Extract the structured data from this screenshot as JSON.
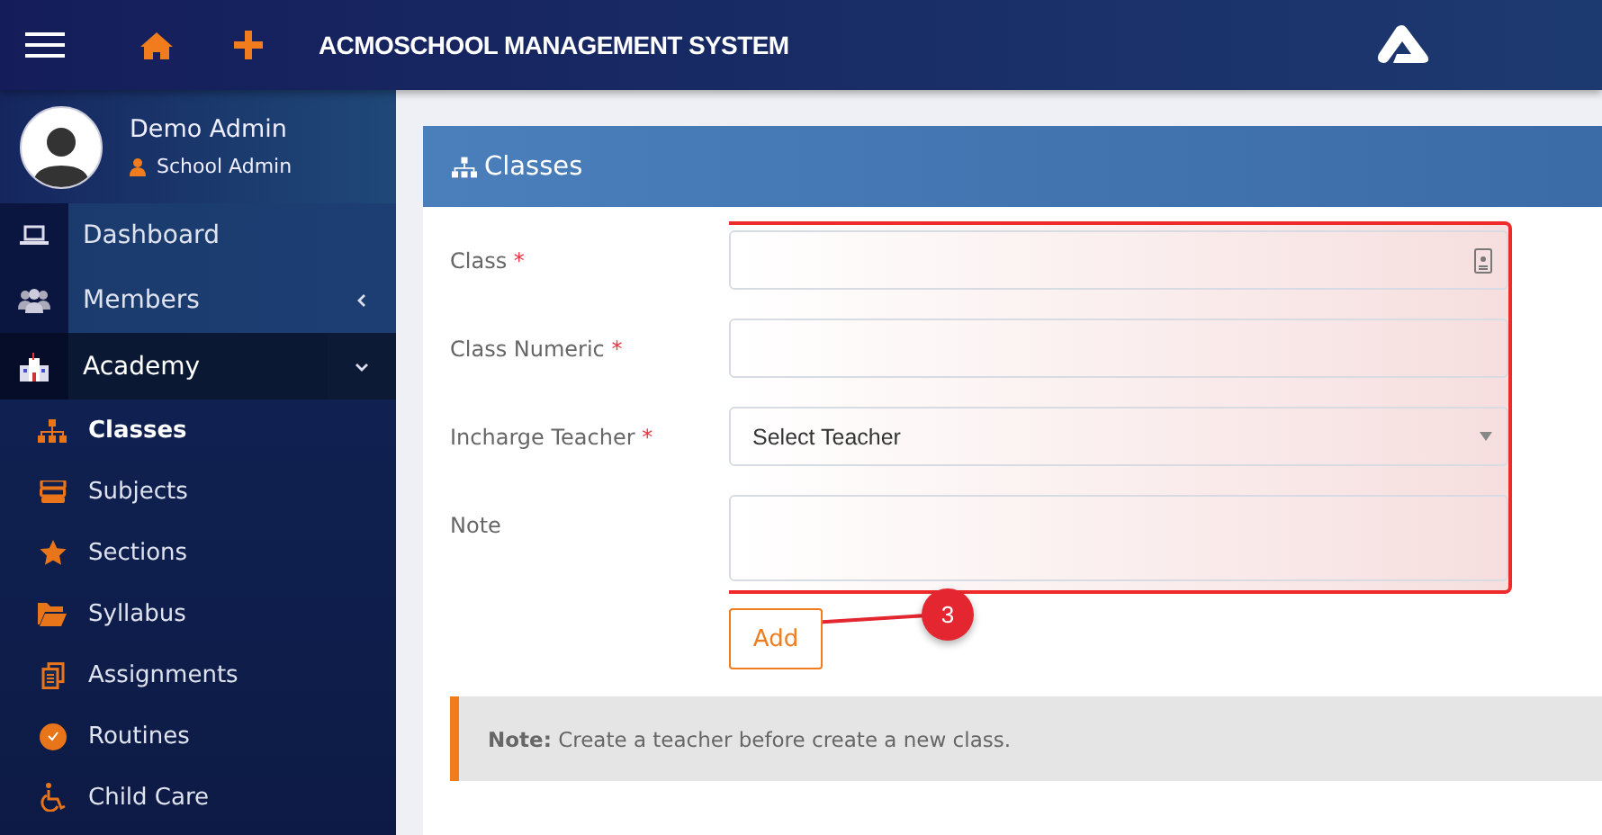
{
  "header": {
    "title": "ACMOSCHOOL MANAGEMENT SYSTEM"
  },
  "user": {
    "name": "Demo Admin",
    "role": "School Admin"
  },
  "sidebar": {
    "items": [
      {
        "label": "Dashboard",
        "selected": false
      },
      {
        "label": "Members",
        "selected": false,
        "expanded": false
      },
      {
        "label": "Academy",
        "selected": true,
        "expanded": true,
        "children": [
          {
            "label": "Classes",
            "selected": true
          },
          {
            "label": "Subjects",
            "selected": false
          },
          {
            "label": "Sections",
            "selected": false
          },
          {
            "label": "Syllabus",
            "selected": false
          },
          {
            "label": "Assignments",
            "selected": false
          },
          {
            "label": "Routines",
            "selected": false
          },
          {
            "label": "Child Care",
            "selected": false
          }
        ]
      }
    ]
  },
  "panel": {
    "title": "Classes",
    "fields": [
      {
        "label": "Class",
        "required_mark": "*",
        "kind": "input"
      },
      {
        "label": "Class Numeric",
        "required_mark": "*",
        "kind": "input"
      },
      {
        "label": "Incharge Teacher",
        "required_mark": "*",
        "kind": "select",
        "value": "Select Teacher"
      },
      {
        "label": "Note",
        "kind": "textarea"
      }
    ],
    "button": "Add",
    "note": "**Note:** Create a teacher before create a new class."
  },
  "annotation": {
    "number": "3"
  }
}
